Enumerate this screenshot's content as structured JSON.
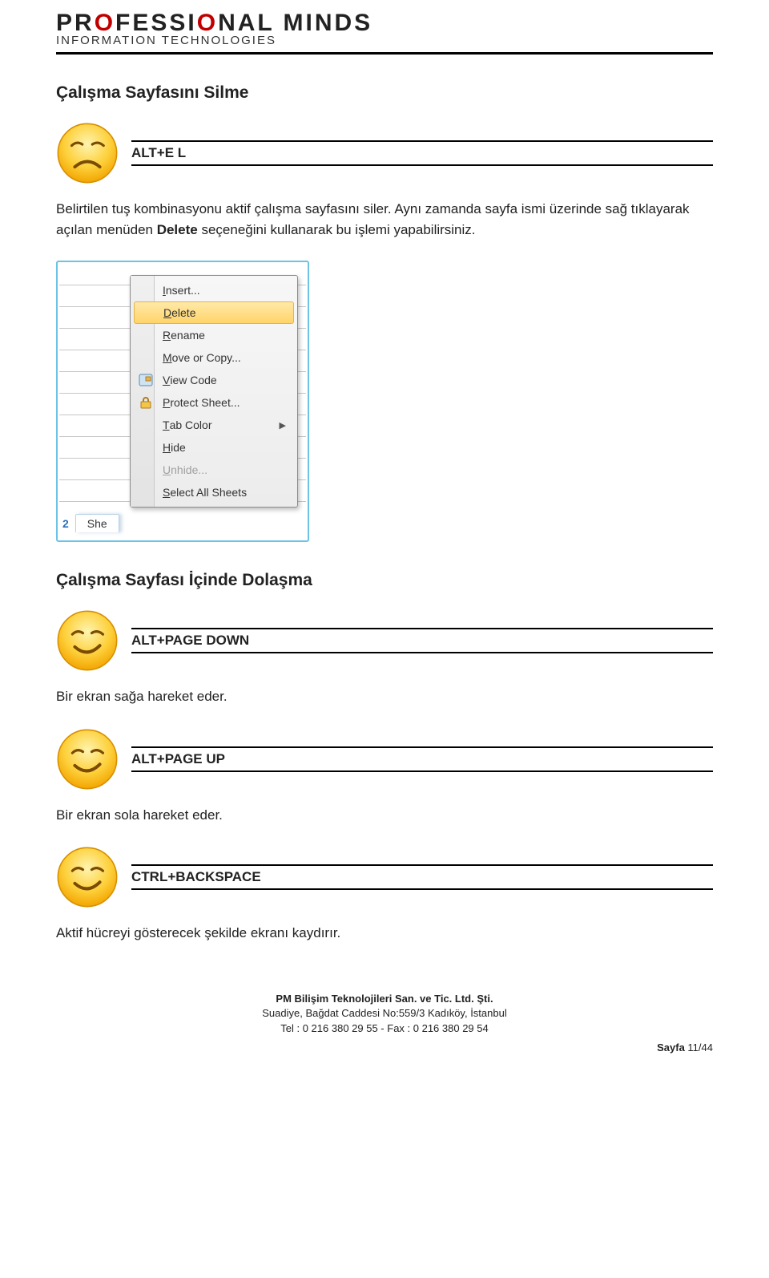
{
  "logo": {
    "main_pref": "PR",
    "main_o": "O",
    "main_rest": "FESSI",
    "main_o2": "O",
    "main_tail": "NAL  MINDS",
    "sub": "INFORMATION TECHNOLOGIES"
  },
  "section1": {
    "title": "Çalışma Sayfasını Silme",
    "key": "ALT+E L",
    "text_pre": "Belirtilen tuş kombinasyonu aktif çalışma sayfasını siler. Aynı zamanda sayfa ismi üzerinde sağ tıklayarak açılan menüden ",
    "text_bold": "Delete",
    "text_post": " seçeneğini kullanarak bu işlemi yapabilirsiniz."
  },
  "menu": {
    "items": [
      {
        "label": "Insert...",
        "u": "I"
      },
      {
        "label": "Delete",
        "u": "D",
        "hl": true
      },
      {
        "label": "Rename",
        "u": "R"
      },
      {
        "label": "Move or Copy...",
        "u": "M"
      },
      {
        "label": "View Code",
        "u": "V",
        "icon": "code"
      },
      {
        "label": "Protect Sheet...",
        "u": "P",
        "icon": "lock"
      },
      {
        "label": "Tab Color",
        "u": "T",
        "sub": true
      },
      {
        "label": "Hide",
        "u": "H"
      },
      {
        "label": "Unhide...",
        "u": "U",
        "disabled": true
      },
      {
        "label": "Select All Sheets",
        "u": "S"
      }
    ],
    "tab_prefix": "2",
    "tab_label": "She"
  },
  "section2": {
    "title": "Çalışma Sayfası İçinde Dolaşma",
    "items": [
      {
        "key": "ALT+PAGE DOWN",
        "text": "Bir ekran sağa hareket eder."
      },
      {
        "key": "ALT+PAGE UP",
        "text": "Bir ekran sola hareket eder."
      },
      {
        "key": "CTRL+BACKSPACE",
        "text": "Aktif hücreyi gösterecek şekilde ekranı kaydırır."
      }
    ]
  },
  "footer": {
    "l1": "PM Bilişim Teknolojileri San. ve Tic. Ltd. Şti.",
    "l2": "Suadiye, Bağdat Caddesi No:559/3 Kadıköy, İstanbul",
    "l3": "Tel : 0 216 380 29 55 - Fax : 0 216 380 29 54",
    "page_label": "Sayfa ",
    "page_cur": "11",
    "page_total": "/44"
  }
}
